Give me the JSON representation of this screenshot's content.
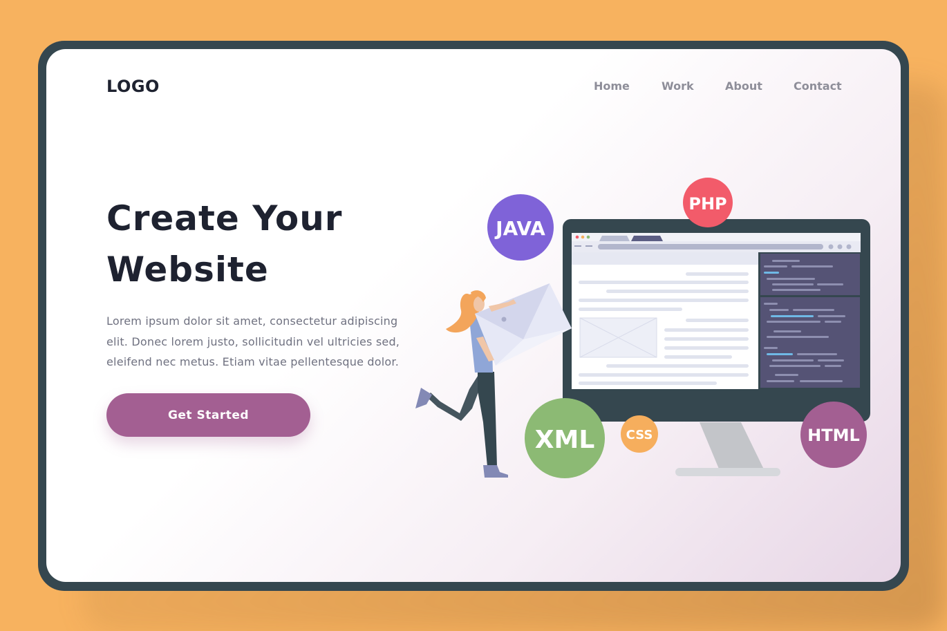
{
  "header": {
    "logo": "LOGO",
    "nav": [
      {
        "label": "Home"
      },
      {
        "label": "Work"
      },
      {
        "label": "About"
      },
      {
        "label": "Contact"
      }
    ]
  },
  "hero": {
    "title_line1": "Create Your",
    "title_line2": "Website",
    "text_line1": "Lorem ipsum dolor sit amet, consectetur  adipiscing",
    "text_line2": "elit. Donec lorem justo, sollicitudin vel ultricies sed,",
    "text_line3": "eleifend nec metus. Etiam vitae pellentesque dolor.",
    "cta_label": "Get Started"
  },
  "illustration": {
    "badges": [
      {
        "label": "JAVA",
        "color": "#7F63D8"
      },
      {
        "label": "PHP",
        "color": "#F25B6A"
      },
      {
        "label": "XML",
        "color": "#8CBA74"
      },
      {
        "label": "CSS",
        "color": "#F6AE5D"
      },
      {
        "label": "HTML",
        "color": "#A35F92"
      }
    ]
  },
  "colors": {
    "background": "#F7B25F",
    "frame": "#35474F",
    "accent": "#A35F92",
    "heading": "#1E2230",
    "body_text": "#6F7180",
    "nav_text": "#8E8E99"
  }
}
